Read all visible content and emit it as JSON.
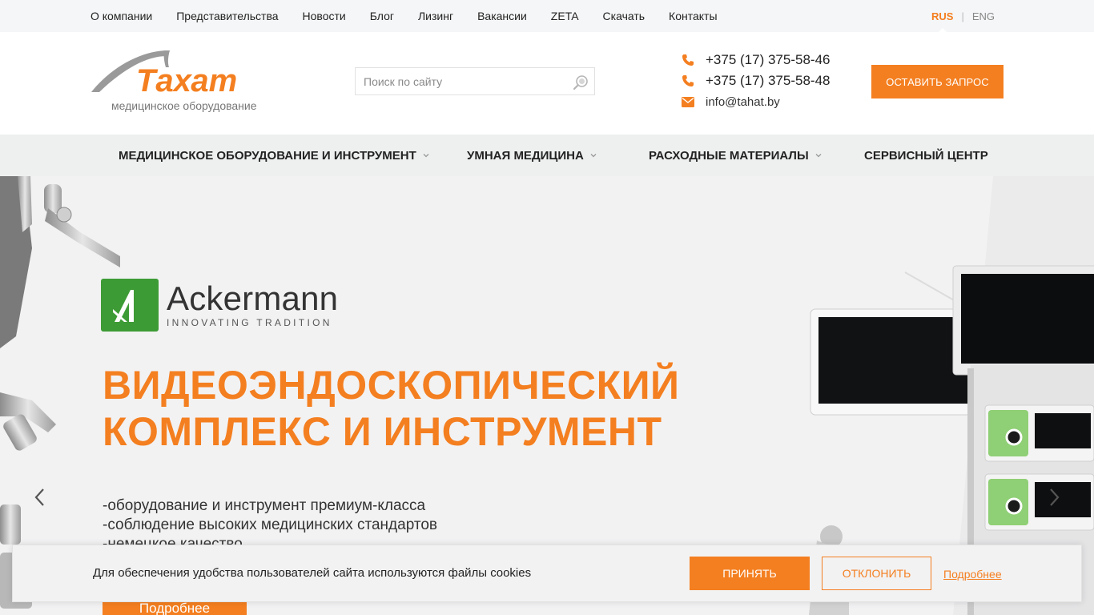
{
  "colors": {
    "accent": "#f47f20",
    "brand_green": "#3d9b35"
  },
  "topnav": {
    "items": [
      "О компании",
      "Представительства",
      "Новости",
      "Блог",
      "Лизинг",
      "Вакансии",
      "ZETA",
      "Скачать",
      "Контакты"
    ]
  },
  "lang": {
    "active": "RUS",
    "separator": "|",
    "other": "ENG"
  },
  "header": {
    "logo_name": "Тахат",
    "logo_subtitle": "медицинское оборудование",
    "search_placeholder": "Поиск по сайту",
    "phones": [
      "+375 (17) 375-58-46",
      "+375 (17) 375-58-48"
    ],
    "email": "info@tahat.by",
    "request_button": "ОСТАВИТЬ ЗАПРОС"
  },
  "mainnav": {
    "items": [
      {
        "label": "МЕДИЦИНСКОЕ ОБОРУДОВАНИЕ И ИНСТРУМЕНТ",
        "dropdown": true
      },
      {
        "label": "УМНАЯ МЕДИЦИНА",
        "dropdown": true
      },
      {
        "label": "РАСХОДНЫЕ МАТЕРИАЛЫ",
        "dropdown": true
      },
      {
        "label": "СЕРВИСНЫЙ ЦЕНТР",
        "dropdown": false
      }
    ]
  },
  "hero": {
    "brand_name": "Ackermann",
    "brand_tagline": "INNOVATING TRADITION",
    "title_line1": "ВИДЕОЭНДОСКОПИЧЕСКИЙ",
    "title_line2": "КОМПЛЕКС И ИНСТРУМЕНТ",
    "bullets": [
      "-оборудование и инструмент премиум-класса",
      "-соблюдение высоких медицинских стандартов",
      "-немецкое качество"
    ],
    "more_button": "Подробнее"
  },
  "cookie": {
    "text": "Для обеспечения удобства пользователей сайта используются файлы cookies",
    "accept": "ПРИНЯТЬ",
    "decline": "ОТКЛОНИТЬ",
    "more": "Подробнее"
  },
  "icons": {
    "phone": "phone-icon",
    "email": "envelope-icon",
    "search": "magnifier-icon",
    "chevron": "chevron-down-icon",
    "prev": "chevron-left-icon",
    "next": "chevron-right-icon"
  }
}
